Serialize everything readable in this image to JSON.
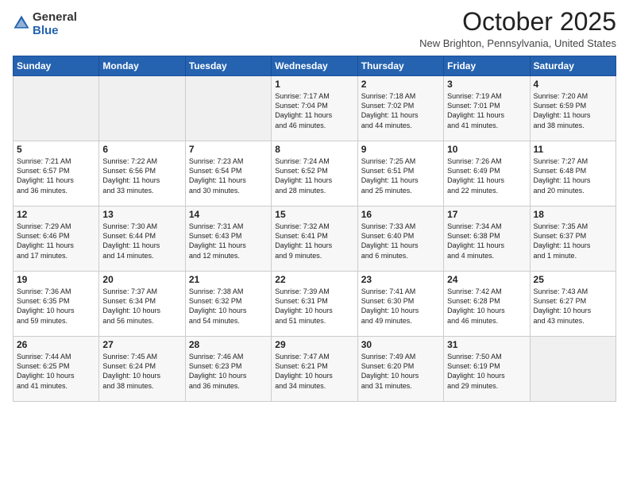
{
  "logo": {
    "general": "General",
    "blue": "Blue"
  },
  "header": {
    "month": "October 2025",
    "location": "New Brighton, Pennsylvania, United States"
  },
  "days_of_week": [
    "Sunday",
    "Monday",
    "Tuesday",
    "Wednesday",
    "Thursday",
    "Friday",
    "Saturday"
  ],
  "weeks": [
    [
      {
        "day": "",
        "info": ""
      },
      {
        "day": "",
        "info": ""
      },
      {
        "day": "",
        "info": ""
      },
      {
        "day": "1",
        "info": "Sunrise: 7:17 AM\nSunset: 7:04 PM\nDaylight: 11 hours\nand 46 minutes."
      },
      {
        "day": "2",
        "info": "Sunrise: 7:18 AM\nSunset: 7:02 PM\nDaylight: 11 hours\nand 44 minutes."
      },
      {
        "day": "3",
        "info": "Sunrise: 7:19 AM\nSunset: 7:01 PM\nDaylight: 11 hours\nand 41 minutes."
      },
      {
        "day": "4",
        "info": "Sunrise: 7:20 AM\nSunset: 6:59 PM\nDaylight: 11 hours\nand 38 minutes."
      }
    ],
    [
      {
        "day": "5",
        "info": "Sunrise: 7:21 AM\nSunset: 6:57 PM\nDaylight: 11 hours\nand 36 minutes."
      },
      {
        "day": "6",
        "info": "Sunrise: 7:22 AM\nSunset: 6:56 PM\nDaylight: 11 hours\nand 33 minutes."
      },
      {
        "day": "7",
        "info": "Sunrise: 7:23 AM\nSunset: 6:54 PM\nDaylight: 11 hours\nand 30 minutes."
      },
      {
        "day": "8",
        "info": "Sunrise: 7:24 AM\nSunset: 6:52 PM\nDaylight: 11 hours\nand 28 minutes."
      },
      {
        "day": "9",
        "info": "Sunrise: 7:25 AM\nSunset: 6:51 PM\nDaylight: 11 hours\nand 25 minutes."
      },
      {
        "day": "10",
        "info": "Sunrise: 7:26 AM\nSunset: 6:49 PM\nDaylight: 11 hours\nand 22 minutes."
      },
      {
        "day": "11",
        "info": "Sunrise: 7:27 AM\nSunset: 6:48 PM\nDaylight: 11 hours\nand 20 minutes."
      }
    ],
    [
      {
        "day": "12",
        "info": "Sunrise: 7:29 AM\nSunset: 6:46 PM\nDaylight: 11 hours\nand 17 minutes."
      },
      {
        "day": "13",
        "info": "Sunrise: 7:30 AM\nSunset: 6:44 PM\nDaylight: 11 hours\nand 14 minutes."
      },
      {
        "day": "14",
        "info": "Sunrise: 7:31 AM\nSunset: 6:43 PM\nDaylight: 11 hours\nand 12 minutes."
      },
      {
        "day": "15",
        "info": "Sunrise: 7:32 AM\nSunset: 6:41 PM\nDaylight: 11 hours\nand 9 minutes."
      },
      {
        "day": "16",
        "info": "Sunrise: 7:33 AM\nSunset: 6:40 PM\nDaylight: 11 hours\nand 6 minutes."
      },
      {
        "day": "17",
        "info": "Sunrise: 7:34 AM\nSunset: 6:38 PM\nDaylight: 11 hours\nand 4 minutes."
      },
      {
        "day": "18",
        "info": "Sunrise: 7:35 AM\nSunset: 6:37 PM\nDaylight: 11 hours\nand 1 minute."
      }
    ],
    [
      {
        "day": "19",
        "info": "Sunrise: 7:36 AM\nSunset: 6:35 PM\nDaylight: 10 hours\nand 59 minutes."
      },
      {
        "day": "20",
        "info": "Sunrise: 7:37 AM\nSunset: 6:34 PM\nDaylight: 10 hours\nand 56 minutes."
      },
      {
        "day": "21",
        "info": "Sunrise: 7:38 AM\nSunset: 6:32 PM\nDaylight: 10 hours\nand 54 minutes."
      },
      {
        "day": "22",
        "info": "Sunrise: 7:39 AM\nSunset: 6:31 PM\nDaylight: 10 hours\nand 51 minutes."
      },
      {
        "day": "23",
        "info": "Sunrise: 7:41 AM\nSunset: 6:30 PM\nDaylight: 10 hours\nand 49 minutes."
      },
      {
        "day": "24",
        "info": "Sunrise: 7:42 AM\nSunset: 6:28 PM\nDaylight: 10 hours\nand 46 minutes."
      },
      {
        "day": "25",
        "info": "Sunrise: 7:43 AM\nSunset: 6:27 PM\nDaylight: 10 hours\nand 43 minutes."
      }
    ],
    [
      {
        "day": "26",
        "info": "Sunrise: 7:44 AM\nSunset: 6:25 PM\nDaylight: 10 hours\nand 41 minutes."
      },
      {
        "day": "27",
        "info": "Sunrise: 7:45 AM\nSunset: 6:24 PM\nDaylight: 10 hours\nand 38 minutes."
      },
      {
        "day": "28",
        "info": "Sunrise: 7:46 AM\nSunset: 6:23 PM\nDaylight: 10 hours\nand 36 minutes."
      },
      {
        "day": "29",
        "info": "Sunrise: 7:47 AM\nSunset: 6:21 PM\nDaylight: 10 hours\nand 34 minutes."
      },
      {
        "day": "30",
        "info": "Sunrise: 7:49 AM\nSunset: 6:20 PM\nDaylight: 10 hours\nand 31 minutes."
      },
      {
        "day": "31",
        "info": "Sunrise: 7:50 AM\nSunset: 6:19 PM\nDaylight: 10 hours\nand 29 minutes."
      },
      {
        "day": "",
        "info": ""
      }
    ]
  ],
  "colors": {
    "header_bg": "#2563b0",
    "header_text": "#ffffff",
    "border": "#cccccc",
    "odd_row": "#f7f7f7",
    "even_row": "#ffffff",
    "empty_cell": "#f0f0f0"
  }
}
